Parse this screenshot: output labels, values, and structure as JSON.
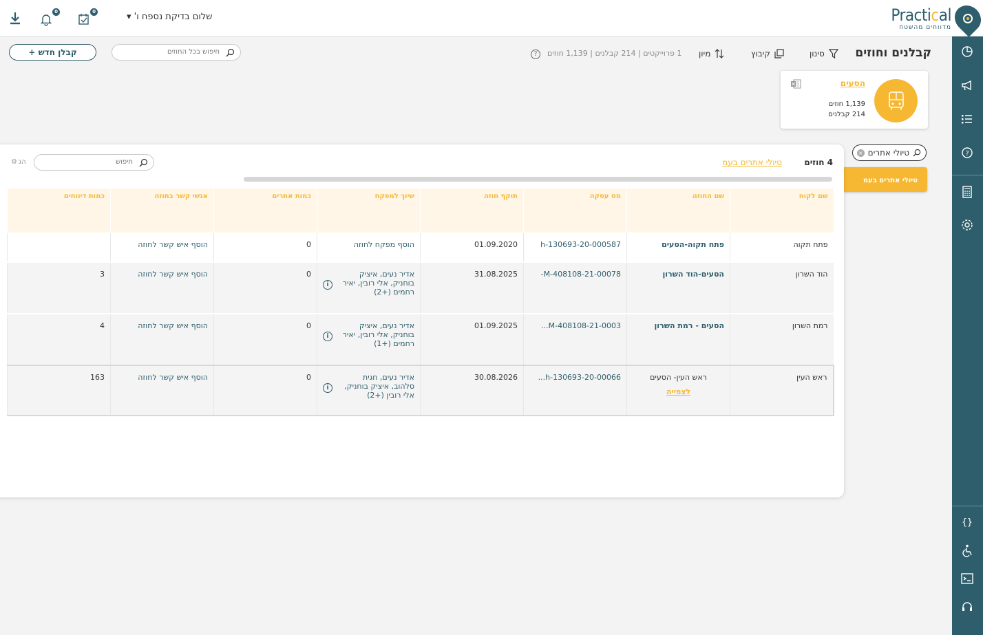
{
  "header": {
    "logo_word": "Practical",
    "logo_sub": "מדווחים מהשטח",
    "greeting": "שלום בדיקת נספח ו'",
    "tasks_badge": "0",
    "notifications_badge": "0"
  },
  "page": {
    "title": "קבלנים וחוזים",
    "filter_label": "סינון",
    "group_label": "קיבוץ",
    "sort_label": "מיון",
    "counts": "1 פרוייקטים | 214 קבלנים | 1,139 חוזים",
    "help": "?",
    "global_search_placeholder": "חיפוש בכל החוזים",
    "new_button": "+ קבלן חדש"
  },
  "card": {
    "title": "הסעים",
    "contracts": "1,139 חוזים",
    "contractors": "214 קבלנים"
  },
  "filter_chip": "טיולי אתרים",
  "list_item": "טיולי אתרים בעמ",
  "panel": {
    "count": "4 חוזים",
    "link": "טיולי אתרים בעמ",
    "search_placeholder": "חיפוש",
    "settings_label": "הג",
    "columns": [
      "שם לקוח",
      "שם החוזה",
      "מס עסקה",
      "תוקף חוזה",
      "שיוך למפקח",
      "כמות אתרים",
      "אנשי קשר בחוזה",
      "כמות דיווחים"
    ],
    "rows": [
      {
        "client": "פתח תקוה",
        "contract": "פתח תקוה-הסעים",
        "deal": "h-130693-20-000587",
        "expiry": "01.09.2020",
        "supervisor": "הוסף מפקח לחוזה",
        "sites": "0",
        "contacts": "הוסף איש קשר לחוזה",
        "reports": ""
      },
      {
        "client": "הוד השרון",
        "contract": "הסעים-הוד השרון",
        "deal": "M-408108-21-00078-",
        "expiry": "31.08.2025",
        "supervisor": "אדיר נעים, איציק בוחניק, אלי רובין, יאיר רחמים (+2)",
        "sites": "0",
        "contacts": "הוסף איש קשר לחוזה",
        "reports": "3"
      },
      {
        "client": "רמת השרון",
        "contract": "הסעים - רמת השרון",
        "deal": "M-408108-21-0003...",
        "expiry": "01.09.2025",
        "supervisor": "אדיר נעים, איציק בוחניק, אלי רובין, יאיר רחמים (+1)",
        "sites": "0",
        "contacts": "הוסף איש קשר לחוזה",
        "reports": "4"
      },
      {
        "client": "ראש העין",
        "contract": "ראש העין- הסעים",
        "view": "לצפייה",
        "deal": "h-130693-20-00066...",
        "expiry": "30.08.2026",
        "supervisor": "אדיר נעים, חגית סלהוב, איציק בוחניק, אלי רובין (+2)",
        "sites": "0",
        "contacts": "הוסף איש קשר לחוזה",
        "reports": "163"
      }
    ]
  },
  "colors": {
    "brand": "#2e5d6b",
    "accent": "#f6b833"
  }
}
